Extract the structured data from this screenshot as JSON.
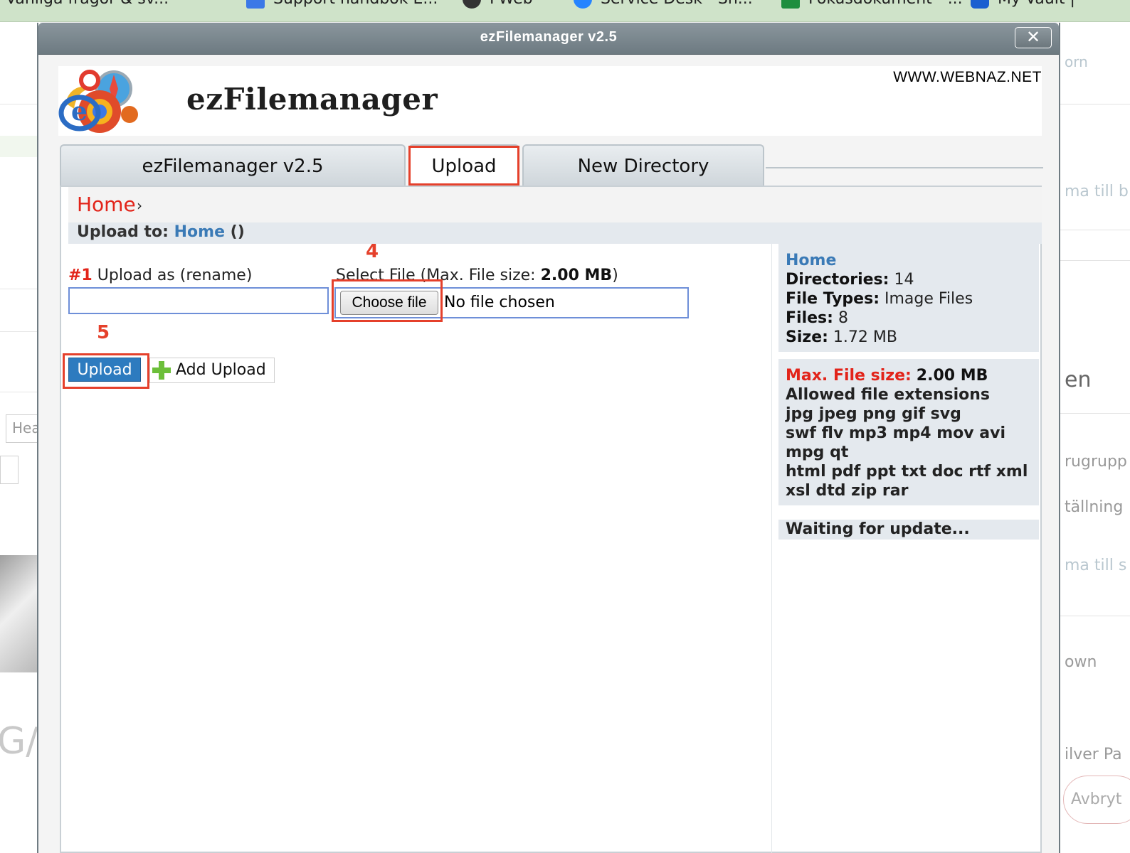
{
  "bookmarks": [
    {
      "label": "Vanliga frågor & sv..."
    },
    {
      "label": "Support handbok E..."
    },
    {
      "label": "FWeb"
    },
    {
      "label": "Service Desk - Sh..."
    },
    {
      "label": "Fokusdokument - ..."
    },
    {
      "label": "My Vault |"
    }
  ],
  "background_right": {
    "items": [
      "orn",
      "ma till b",
      "en",
      "rugrupp",
      "tällning",
      "ma till s",
      "own",
      "ilver Pa",
      "Avbryt"
    ]
  },
  "background_left": {
    "items": [
      "Hea",
      "G/"
    ]
  },
  "dialog": {
    "title": "ezFilemanager v2.5",
    "close_label": "✕"
  },
  "header": {
    "brand": "ezFilemanager",
    "site": "WWW.WEBNAZ.NET"
  },
  "tabs": [
    {
      "label": "ezFilemanager v2.5"
    },
    {
      "label": "Upload"
    },
    {
      "label": "New Directory"
    }
  ],
  "breadcrumb": {
    "home": "Home",
    "separator": "›"
  },
  "upload_to": {
    "label": "Upload to:",
    "dir": "Home",
    "suffix": "()"
  },
  "annotations": {
    "step4": "4",
    "step5": "5"
  },
  "form": {
    "rename_number": "#1",
    "rename_label": "Upload as (rename)",
    "rename_value": "",
    "select_prefix": "Select File (Max. File size: ",
    "select_size": "2.00 MB",
    "select_suffix": ")",
    "choose_file": "Choose file",
    "no_file": "No file chosen",
    "upload_button": "Upload",
    "add_upload": "Add Upload"
  },
  "info": {
    "title": "Home",
    "directories_label": "Directories:",
    "directories_value": "14",
    "filetypes_label": "File Types:",
    "filetypes_value": "Image Files",
    "files_label": "Files:",
    "files_value": "8",
    "size_label": "Size:",
    "size_value": "1.72 MB",
    "max_label": "Max. File size:",
    "max_value": "2.00 MB",
    "allowed_label": "Allowed file extensions",
    "ext_lines": [
      "jpg jpeg png gif svg",
      "swf flv mp3 mp4 mov avi",
      "mpg qt",
      "html pdf ppt txt doc rtf xml",
      "xsl dtd zip rar"
    ],
    "status": "Waiting for update..."
  },
  "colors": {
    "accent_red": "#e2241a",
    "annotation_red": "#e5402b",
    "link_blue": "#3a7ab6",
    "button_blue": "#2d7bbf"
  }
}
